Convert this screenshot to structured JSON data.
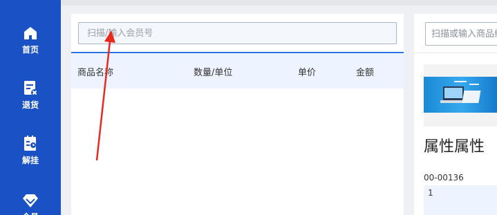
{
  "sidebar": {
    "items": [
      {
        "label": "首页",
        "icon": "home-icon"
      },
      {
        "label": "退货",
        "icon": "return-icon"
      },
      {
        "label": "解挂",
        "icon": "unhang-icon"
      },
      {
        "label": "会员",
        "icon": "diamond-icon"
      }
    ]
  },
  "member": {
    "placeholder": "扫描/输入会员号"
  },
  "table": {
    "headers": [
      "商品名称",
      "数量/单位",
      "单价",
      "金额"
    ]
  },
  "product_panel": {
    "search_placeholder": "扫描或输入商品编码",
    "product": {
      "name": "属性属性",
      "code": "00-00136",
      "quantity": "1"
    }
  },
  "colors": {
    "sidebar": "#1a52c5",
    "accent": "#2b73e8",
    "annotation_arrow": "#e8291c"
  }
}
